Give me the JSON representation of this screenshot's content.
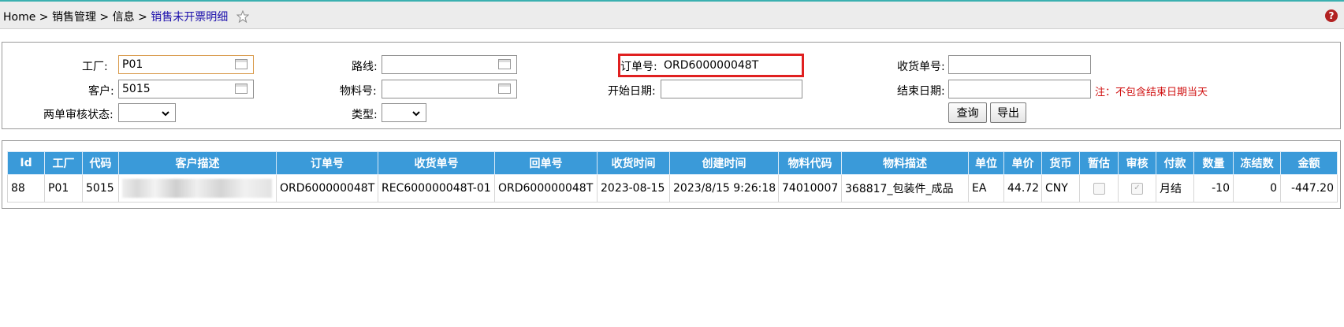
{
  "breadcrumb": {
    "home": "Home",
    "sep": " > ",
    "level1": "销售管理",
    "level2": "信息",
    "current": "销售未开票明细"
  },
  "help_icon_text": "?",
  "form": {
    "factory_label": "工厂:",
    "factory_value": "P01",
    "route_label": "路线:",
    "route_value": "",
    "order_no_label": "订单号:",
    "order_no_value": "ORD600000048T",
    "receipt_no_label": "收货单号:",
    "receipt_no_value": "",
    "customer_label": "客户:",
    "customer_value": "5015",
    "material_no_label": "物料号:",
    "material_no_value": "",
    "start_date_label": "开始日期:",
    "start_date_value": "",
    "end_date_label": "结束日期:",
    "end_date_value": "",
    "end_date_note": "注：不包含结束日期当天",
    "audit_status_label": "两单审核状态:",
    "audit_status_value": "",
    "type_label": "类型:",
    "type_value": "",
    "query_button": "查询",
    "export_button": "导出"
  },
  "table": {
    "headers": [
      "Id",
      "工厂",
      "代码",
      "客户描述",
      "订单号",
      "收货单号",
      "回单号",
      "收货时间",
      "创建时间",
      "物料代码",
      "物料描述",
      "单位",
      "单价",
      "货币",
      "暂估",
      "审核",
      "付款",
      "数量",
      "冻结数",
      "金额"
    ],
    "rows": [
      {
        "id": "88",
        "factory": "P01",
        "code": "5015",
        "customer_desc": "",
        "order_no": "ORD600000048T",
        "receipt_no": "REC600000048T-01",
        "return_no": "ORD600000048T",
        "receipt_time": "2023-08-15",
        "create_time": "2023/8/15 9:26:18",
        "material_code": "74010007",
        "material_desc": "368817_包装件_成品",
        "unit": "EA",
        "unit_price": "44.72",
        "currency": "CNY",
        "provisional": false,
        "audited": true,
        "payment": "月结",
        "quantity": "-10",
        "frozen_qty": "0",
        "amount": "-447.20"
      }
    ]
  },
  "colors": {
    "header_bg": "#3a9ad9",
    "highlight_border": "#e02020",
    "note_color": "#d01010",
    "breadcrumb_current": "#1a0dab"
  }
}
